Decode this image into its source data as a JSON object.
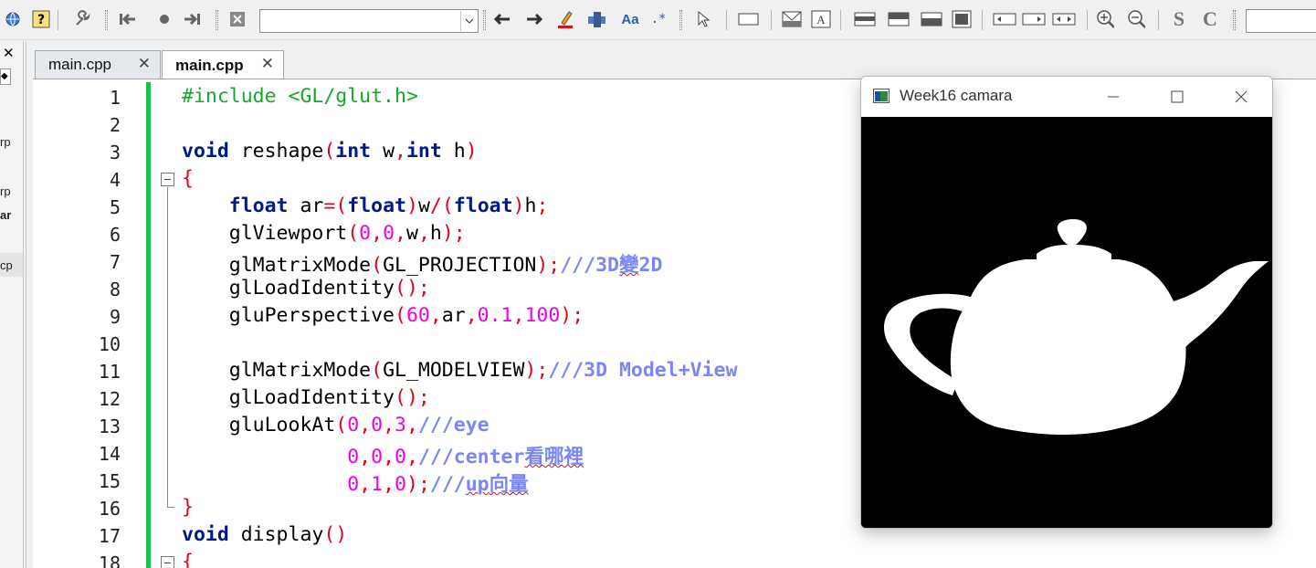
{
  "toolbar": {
    "scope_value": "",
    "search_value": "",
    "bold_s": "S",
    "bold_c": "C",
    "font_icon_text": "Aa",
    "regex_icon_text": ".*"
  },
  "management_panel": {
    "fragments": [
      "rp",
      "rp",
      "ar",
      "cp"
    ]
  },
  "editor": {
    "tabs": [
      {
        "label": "main.cpp",
        "active": false
      },
      {
        "label": "main.cpp",
        "active": true
      }
    ],
    "line_numbers": [
      "1",
      "2",
      "3",
      "4",
      "5",
      "6",
      "7",
      "8",
      "9",
      "10",
      "11",
      "12",
      "13",
      "14",
      "15",
      "16",
      "17",
      "18"
    ],
    "code_lines": [
      "#include <GL/glut.h>",
      "",
      "void reshape(int w,int h)",
      "{",
      "    float ar=(float)w/(float)h;",
      "    glViewport(0,0,w,h);",
      "    glMatrixMode(GL_PROJECTION);///3D變2D",
      "    glLoadIdentity();",
      "    gluPerspective(60,ar,0.1,100);",
      "",
      "    glMatrixMode(GL_MODELVIEW);///3D Model+View",
      "    glLoadIdentity();",
      "    gluLookAt(0,0,3,///eye",
      "              0,0,0,///center看哪裡",
      "              0,1,0);///up向量",
      "}",
      "void display()",
      "{"
    ],
    "accent_change_bar": "#18c54a"
  },
  "glut_window": {
    "title": "Week16 camara",
    "background": "#000000",
    "object": "teapot"
  }
}
